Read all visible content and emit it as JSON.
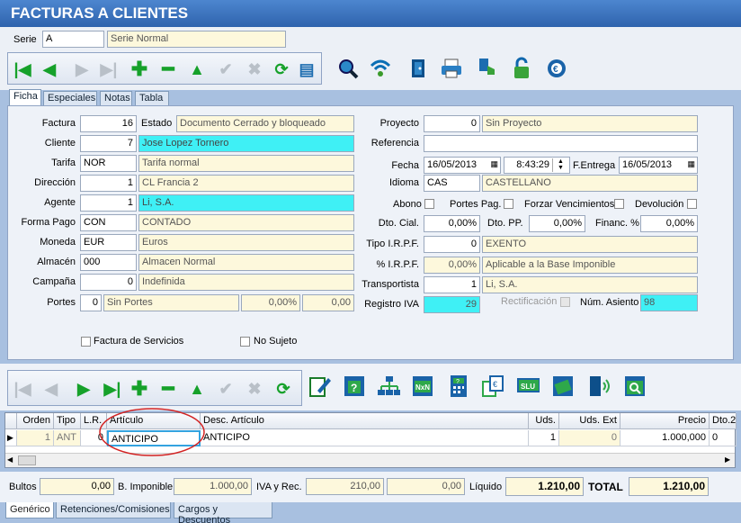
{
  "window": {
    "title": "FACTURAS A CLIENTES"
  },
  "serie": {
    "label": "Serie",
    "code": "A",
    "name": "Serie Normal"
  },
  "tabs": [
    "Ficha",
    "Especiales",
    "Notas",
    "Tabla"
  ],
  "form": {
    "factura": {
      "label": "Factura",
      "value": "16"
    },
    "estado": {
      "label": "Estado",
      "value": "Documento Cerrado y bloqueado"
    },
    "cliente": {
      "label": "Cliente",
      "code": "7",
      "name": "Jose Lopez Tornero"
    },
    "tarifa": {
      "label": "Tarifa",
      "code": "NOR",
      "name": "Tarifa normal"
    },
    "direccion": {
      "label": "Dirección",
      "code": "1",
      "name": " CL  Francia 2"
    },
    "agente": {
      "label": "Agente",
      "code": "1",
      "name": "Li, S.A."
    },
    "forma_pago": {
      "label": "Forma Pago",
      "code": "CON",
      "name": "CONTADO"
    },
    "moneda": {
      "label": "Moneda",
      "code": "EUR",
      "name": "Euros"
    },
    "almacen": {
      "label": "Almacén",
      "code": "000",
      "name": "Almacen Normal"
    },
    "campana": {
      "label": "Campaña",
      "code": "0",
      "name": "Indefinida"
    },
    "portes": {
      "label": "Portes",
      "code": "0",
      "name": "Sin Portes",
      "pct": "0,00%",
      "amount": "0,00"
    },
    "proyecto": {
      "label": "Proyecto",
      "code": "0",
      "name": "Sin Proyecto"
    },
    "referencia": {
      "label": "Referencia",
      "value": ""
    },
    "fecha": {
      "label": "Fecha",
      "date": "16/05/2013",
      "time": "8:43:29"
    },
    "f_entrega": {
      "label": "F.Entrega",
      "date": "16/05/2013"
    },
    "idioma": {
      "label": "Idioma",
      "code": "CAS",
      "name": "CASTELLANO"
    },
    "abono": "Abono",
    "portes_pag": "Portes Pag.",
    "forzar_venc": "Forzar Vencimientos",
    "devolucion": "Devolución",
    "dto_cial": {
      "label": "Dto. Cial.",
      "value": "0,00%"
    },
    "dto_pp": {
      "label": "Dto. PP.",
      "value": "0,00%"
    },
    "financ": {
      "label": "Financ. %",
      "value": "0,00%"
    },
    "tipo_irpf": {
      "label": "Tipo I.R.P.F.",
      "code": "0",
      "name": "EXENTO"
    },
    "pct_irpf": {
      "label": "% I.R.P.F.",
      "value": "0,00%",
      "name": "Aplicable a la Base Imponible"
    },
    "transportista": {
      "label": "Transportista",
      "code": "1",
      "name": "Li, S.A."
    },
    "registro_iva": {
      "label": "Registro IVA",
      "value": "29"
    },
    "rectificacion": "Rectificación",
    "num_asiento": {
      "label": "Núm. Asiento",
      "value": "98"
    },
    "factura_servicios": "Factura de Servicios",
    "no_sujeto": "No Sujeto"
  },
  "grid": {
    "headers": [
      "Orden",
      "Tipo",
      "L.R.",
      "Artículo",
      "Desc. Artículo",
      "Uds.",
      "Uds. Ext",
      "Precio",
      "Dto.2"
    ],
    "row": {
      "orden": "1",
      "tipo": "ANT",
      "lr": "0",
      "articulo": "ANTICIPO",
      "desc": "ANTICIPO",
      "uds": "1",
      "uds_ext": "0",
      "precio": "1.000,000",
      "dto2": "0"
    }
  },
  "totals": {
    "bultos": {
      "label": "Bultos",
      "value": "0,00"
    },
    "base": {
      "label": "B. Imponible",
      "value": "1.000,00"
    },
    "iva": {
      "label": "IVA y Rec.",
      "value": "210,00",
      "rec": "0,00"
    },
    "liquido": {
      "label": "Líquido",
      "value": "1.210,00"
    },
    "total": {
      "label": "TOTAL",
      "value": "1.210,00"
    }
  },
  "bottom_tabs": [
    "Genérico",
    "Retenciones/Comisiones",
    "Cargos y Descuentos"
  ]
}
